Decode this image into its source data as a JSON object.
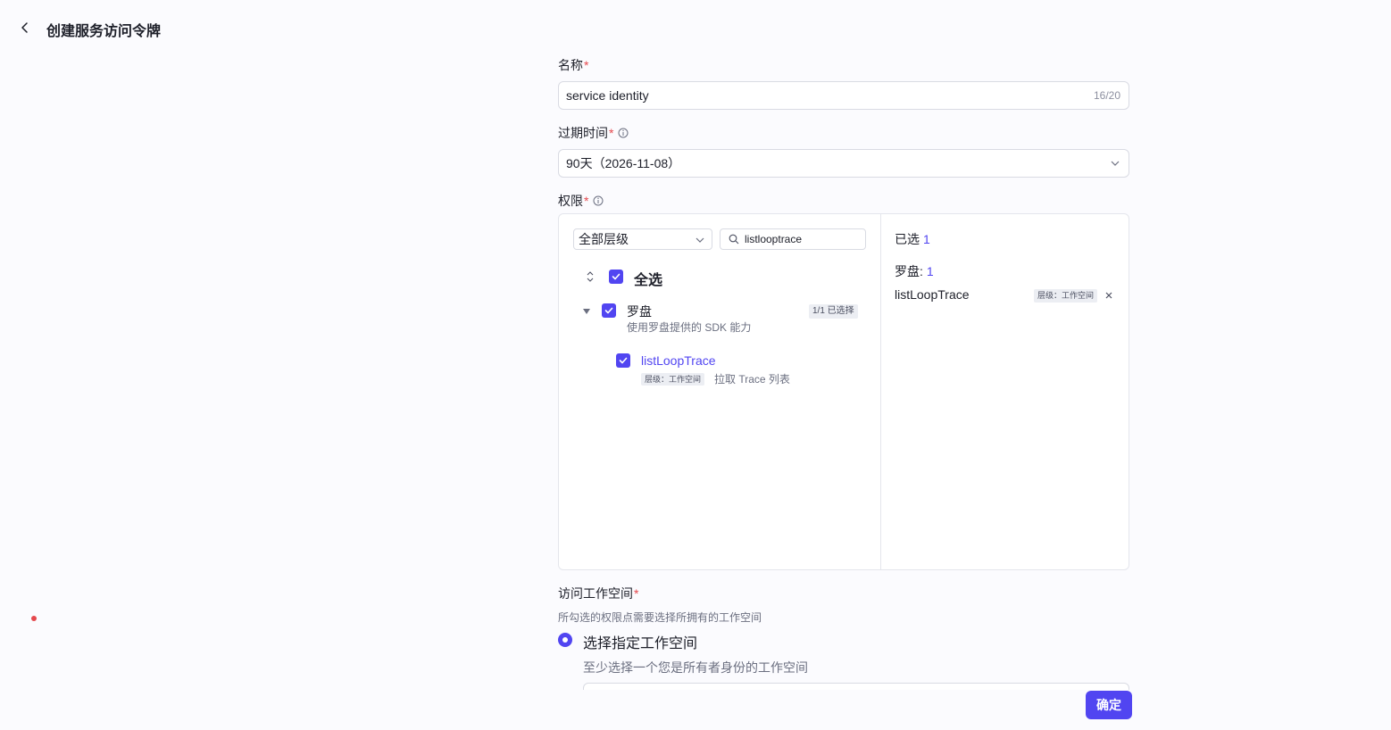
{
  "header": {
    "title": "创建服务访问令牌"
  },
  "name": {
    "label": "名称",
    "required": "*",
    "value": "service identity",
    "count": "16/20"
  },
  "expiry": {
    "label": "过期时间",
    "required": "*",
    "value": "90天（2026-11-08）"
  },
  "permission": {
    "label": "权限",
    "required": "*",
    "level_filter": "全部层级",
    "search_value": "listlooptrace",
    "select_all_label": "全选",
    "group": {
      "name": "罗盘",
      "description": "使用罗盘提供的 SDK 能力",
      "badge": "1/1 已选择",
      "items": [
        {
          "name": "listLoopTrace",
          "level_tag": "层级：工作空间",
          "description": "拉取 Trace 列表"
        }
      ]
    },
    "selected": {
      "title": "已选",
      "count": "1",
      "group_name": "罗盘:",
      "group_count": "1",
      "items": [
        {
          "name": "listLoopTrace",
          "level_tag": "层级：工作空间"
        }
      ]
    }
  },
  "workspace": {
    "label": "访问工作空间",
    "required": "*",
    "hint": "所勾选的权限点需要选择所拥有的工作空间",
    "option_label": "选择指定工作空间",
    "option_sub": "至少选择一个您是所有者身份的工作空间"
  },
  "footer": {
    "confirm_label": "确定"
  },
  "colors": {
    "accent": "#5145f1",
    "required": "#e5484d"
  }
}
